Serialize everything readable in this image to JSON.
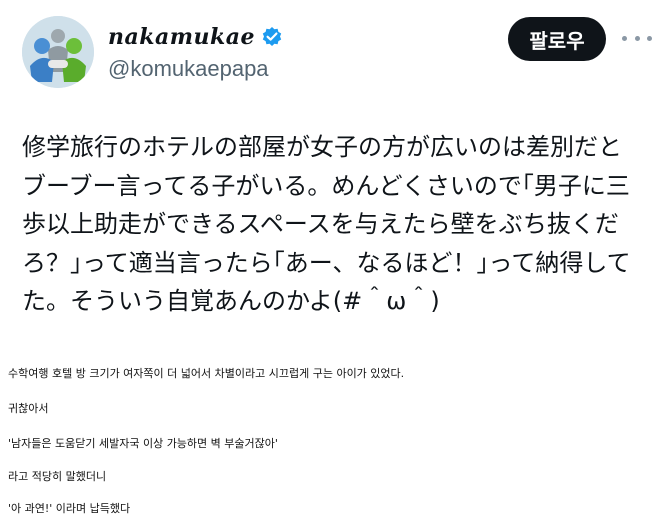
{
  "header": {
    "display_name": "nakamukae",
    "handle": "@komukaepapa",
    "follow_label": "팔로우",
    "verified_color": "#1d9bf0"
  },
  "tweet": {
    "lines": [
      "修学旅行のホテルの部屋が女子の方が広いのは差別だと",
      "ブーブー言ってる子がいる。めんどくさいので｢男子に三",
      "歩以上助走ができるスペースを与えたら壁をぶち抜くだ",
      "ろ？｣って適当言ったら｢あー、なるほど！｣って納得して",
      "た。そういう自覚あんのかよ(#＾ω＾)"
    ]
  },
  "translation": {
    "lines": [
      "수학여행 호텔 방 크기가 여자쪽이 더 넓어서 차별이라고 시끄럽게 구는 아이가 있었다.",
      "귀찮아서",
      "'남자들은 도움닫기 세발자국 이상 가능하면 벽 부술거잖아'",
      "라고 적당히 말했더니",
      "'아 과연!' 이라며 납득했다"
    ]
  },
  "icons": {
    "avatar": "avatar-icon",
    "verified": "verified-badge-icon",
    "more": "more-options-icon"
  }
}
